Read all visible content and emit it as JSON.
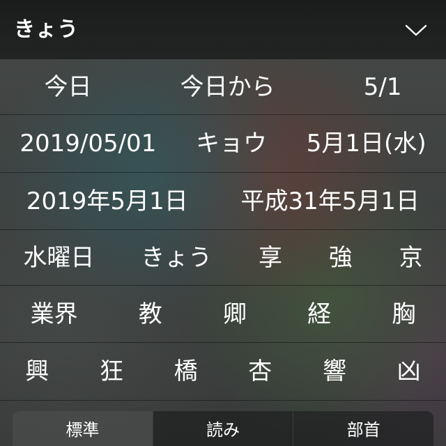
{
  "header": {
    "reading": "きょう",
    "collapse_icon": "chevron-down-icon"
  },
  "rows": [
    [
      "今日",
      "今日から",
      "5/1"
    ],
    [
      "2019/05/01",
      "キョウ",
      "5月1日(水)"
    ],
    [
      "2019年5月1日",
      "平成31年5月1日"
    ],
    [
      "水曜日",
      "きょう",
      "享",
      "強",
      "京"
    ],
    [
      "業界",
      "教",
      "卿",
      "経",
      "胸"
    ],
    [
      "興",
      "狂",
      "橋",
      "杏",
      "響",
      "凶"
    ]
  ],
  "sort_modes": [
    {
      "label": "標準",
      "selected": true
    },
    {
      "label": "読み",
      "selected": false
    },
    {
      "label": "部首",
      "selected": false
    }
  ],
  "colors": {
    "header_bg": "#1b1c1c",
    "text": "#ffffff",
    "selected_segment": "rgba(255,255,255,0.15)"
  }
}
